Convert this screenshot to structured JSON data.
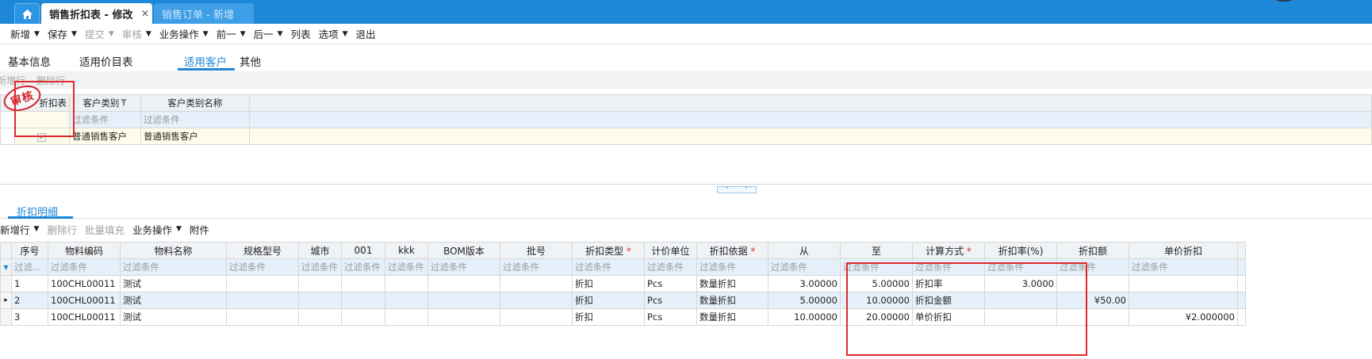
{
  "window": {
    "home_icon": "home-icon",
    "tabs": [
      {
        "label": "销售折扣表 - 修改",
        "close": "×"
      },
      {
        "label": "销售订单 - 新增"
      }
    ]
  },
  "toolbar": {
    "items": [
      {
        "label": "新增",
        "caret": "▼"
      },
      {
        "label": "保存",
        "caret": "▼"
      },
      {
        "label": "提交",
        "caret": "▼"
      },
      {
        "label": "审核",
        "caret": "▼"
      },
      {
        "label": "业务操作",
        "caret": "▼"
      },
      {
        "label": "前一",
        "caret": "▼"
      },
      {
        "label": "后一",
        "caret": "▼"
      },
      {
        "label": "列表"
      },
      {
        "label": "选项",
        "caret": "▼"
      },
      {
        "label": "退出"
      }
    ]
  },
  "subtabs": [
    "基本信息",
    "适用价目表",
    "适用客户",
    "其他"
  ],
  "top_grid": {
    "actions": [
      "新增行",
      "删除行"
    ],
    "headers": [
      "折扣表",
      "客户类别",
      "客户类别名称"
    ],
    "filter": "过滤条件",
    "row": {
      "checkbox": "✓",
      "category": "普通销售客户",
      "category_name": "普通销售客户"
    },
    "stamp": "审核"
  },
  "splitter": {
    "up": "˄",
    "down": "˅"
  },
  "detail": {
    "section_title": "折扣明细",
    "actions": [
      {
        "label": "新增行",
        "caret": "▼"
      },
      {
        "label": "删除行"
      },
      {
        "label": "批量填充"
      },
      {
        "label": "业务操作",
        "caret": "▼"
      },
      {
        "label": "附件"
      }
    ],
    "headers": [
      "序号",
      "物料编码",
      "物料名称",
      "规格型号",
      "城市",
      "001",
      "kkk",
      "BOM版本",
      "批号",
      "折扣类型",
      "计价单位",
      "折扣依据",
      "从",
      "至",
      "计算方式",
      "折扣率(%)",
      "折扣额",
      "单价折扣"
    ],
    "required_mark": "*",
    "filter_text": "过滤条件",
    "filter_short": "过滤...",
    "filter_marker": "▼",
    "row_pointer": "▸",
    "rows": [
      {
        "seq": "1",
        "code": "100CHL00011",
        "name": "测试",
        "type": "折扣",
        "unit": "Pcs",
        "basis": "数量折扣",
        "from": "3.00000",
        "to": "5.00000",
        "method": "折扣率",
        "rate": "3.0000",
        "amount": "",
        "unit_disc": ""
      },
      {
        "seq": "2",
        "code": "100CHL00011",
        "name": "测试",
        "type": "折扣",
        "unit": "Pcs",
        "basis": "数量折扣",
        "from": "5.00000",
        "to": "10.00000",
        "method": "折扣金额",
        "rate": "",
        "amount": "¥50.00",
        "unit_disc": ""
      },
      {
        "seq": "3",
        "code": "100CHL00011",
        "name": "测试",
        "type": "折扣",
        "unit": "Pcs",
        "basis": "数量折扣",
        "from": "10.00000",
        "to": "20.00000",
        "method": "单价折扣",
        "rate": "",
        "amount": "",
        "unit_disc": "¥2.000000"
      }
    ]
  },
  "colors": {
    "accent": "#1d87d6",
    "titlebar": "#1e88d8",
    "highlight": "#e02a2a"
  }
}
